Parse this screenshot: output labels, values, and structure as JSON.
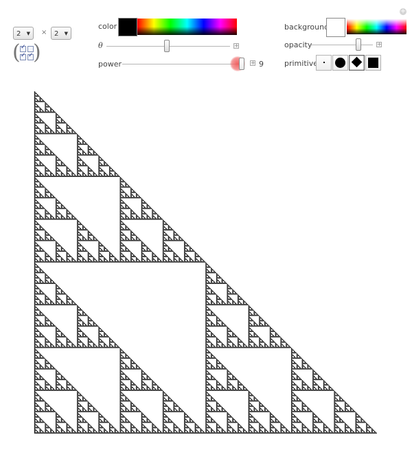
{
  "matrix_controls": {
    "rows_value": "2",
    "cols_value": "2",
    "times_symbol": "×",
    "cells": [
      true,
      false,
      true,
      true
    ]
  },
  "controls": {
    "color_label": "color",
    "theta_label": "θ",
    "power_label": "power",
    "power_value": "9",
    "background_label": "background",
    "opacity_label": "opacity",
    "primitive_label": "primitive",
    "primitive_options": [
      "point",
      "disk",
      "diamond",
      "square"
    ],
    "primitive_selected": "diamond",
    "color_value": "#000000",
    "background_value": "#ffffff",
    "theta_level": 0.47,
    "power_level": 1.0,
    "opacity_level": 0.77
  },
  "graphic": {
    "type": "sierpinski-triangle",
    "depth": 9,
    "fill_color": "#000000"
  }
}
